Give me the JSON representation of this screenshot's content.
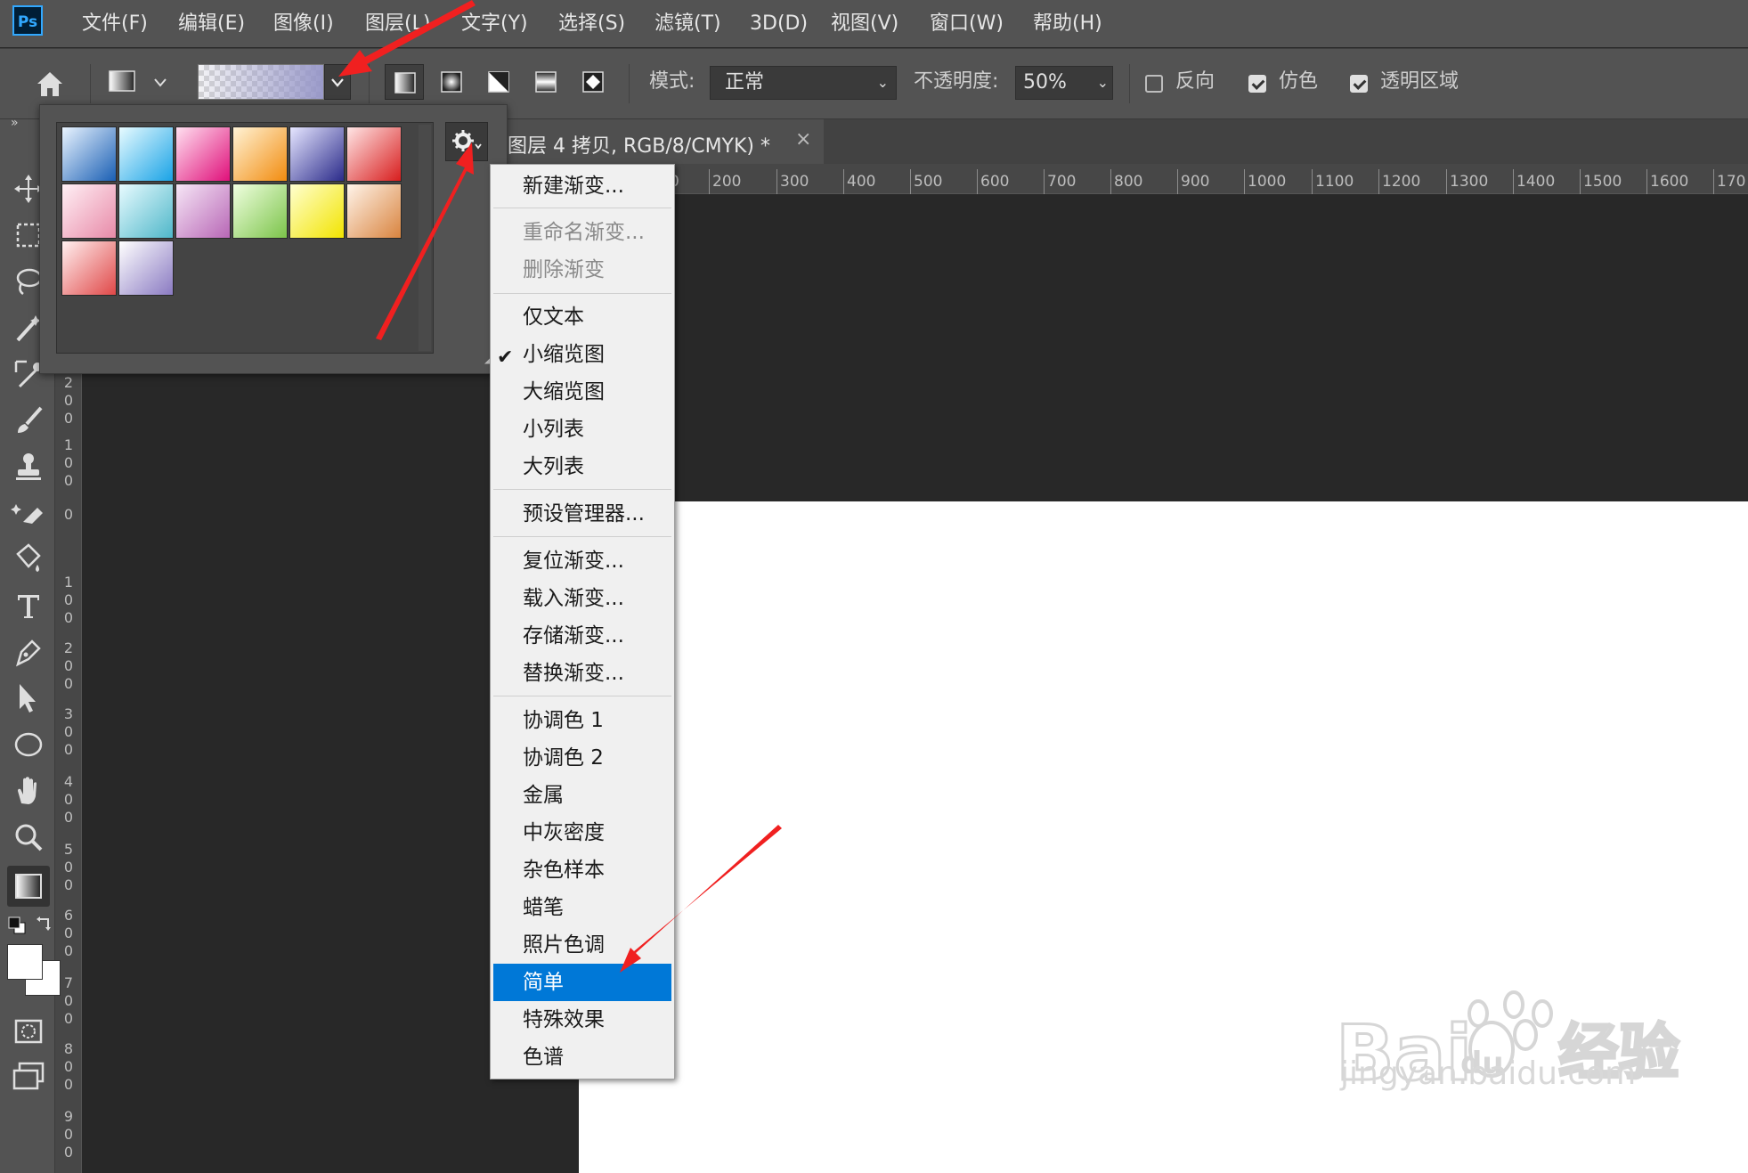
{
  "app": {
    "logo": "Ps"
  },
  "menubar": {
    "items": [
      "文件(F)",
      "编辑(E)",
      "图像(I)",
      "图层(L)",
      "文字(Y)",
      "选择(S)",
      "滤镜(T)",
      "3D(D)",
      "视图(V)",
      "窗口(W)",
      "帮助(H)"
    ]
  },
  "options": {
    "mode_label": "模式:",
    "mode_value": "正常",
    "opacity_label": "不透明度:",
    "opacity_value": "50%",
    "reverse_label": "反向",
    "reverse_checked": false,
    "dither_label": "仿色",
    "dither_checked": true,
    "transparency_label": "透明区域",
    "transparency_checked": true
  },
  "document": {
    "tab_title": "图层 4 拷贝, RGB/8/CMYK) *",
    "close_glyph": "×"
  },
  "ruler": {
    "horizontal": [
      "0",
      "200",
      "300",
      "400",
      "500",
      "600",
      "700",
      "800",
      "900",
      "1000",
      "1100",
      "1200",
      "1300",
      "1400",
      "1500",
      "1600",
      "170"
    ],
    "vertical": [
      "2",
      "0",
      "0",
      "1",
      "0",
      "0",
      "0",
      "1",
      "0",
      "0",
      "2",
      "0",
      "0",
      "3",
      "0",
      "0",
      "4",
      "0",
      "0",
      "5",
      "0",
      "0",
      "6",
      "0",
      "0",
      "7",
      "0",
      "0",
      "8",
      "0",
      "0",
      "9",
      "0",
      "0"
    ]
  },
  "picker": {
    "swatches": [
      {
        "from": "#eaf4ff",
        "to": "#1a5fb4"
      },
      {
        "from": "#e8fbff",
        "to": "#1aa3e6"
      },
      {
        "from": "#ffe0f0",
        "to": "#e0107a"
      },
      {
        "from": "#fff3d6",
        "to": "#f28c0f"
      },
      {
        "from": "#e6e6ff",
        "to": "#2b2b8a"
      },
      {
        "from": "#ffe6e6",
        "to": "#d81e1e"
      },
      {
        "from": "#fff0f5",
        "to": "#e88aa8"
      },
      {
        "from": "#e8fbff",
        "to": "#4fb7c9"
      },
      {
        "from": "#f6e6f6",
        "to": "#b867b6"
      },
      {
        "from": "#f0ffe0",
        "to": "#7cc44a"
      },
      {
        "from": "#ffffd0",
        "to": "#f2e400"
      },
      {
        "from": "#fff4ea",
        "to": "#d9843f"
      },
      {
        "from": "#fff0f0",
        "to": "#e04848"
      },
      {
        "from": "#ffffff",
        "to": "#8a7ac2"
      }
    ]
  },
  "menu": {
    "items": [
      {
        "label": "新建渐变...",
        "disabled": false
      },
      {
        "label": "重命名渐变...",
        "disabled": true
      },
      {
        "label": "删除渐变",
        "disabled": true
      },
      {
        "label": "仅文本",
        "disabled": false
      },
      {
        "label": "小缩览图",
        "disabled": false,
        "checked": true
      },
      {
        "label": "大缩览图",
        "disabled": false
      },
      {
        "label": "小列表",
        "disabled": false
      },
      {
        "label": "大列表",
        "disabled": false
      },
      {
        "label": "预设管理器...",
        "disabled": false
      },
      {
        "label": "复位渐变...",
        "disabled": false
      },
      {
        "label": "载入渐变...",
        "disabled": false
      },
      {
        "label": "存储渐变...",
        "disabled": false
      },
      {
        "label": "替换渐变...",
        "disabled": false
      },
      {
        "label": "协调色 1",
        "disabled": false
      },
      {
        "label": "协调色 2",
        "disabled": false
      },
      {
        "label": "金属",
        "disabled": false
      },
      {
        "label": "中灰密度",
        "disabled": false
      },
      {
        "label": "杂色样本",
        "disabled": false
      },
      {
        "label": "蜡笔",
        "disabled": false
      },
      {
        "label": "照片色调",
        "disabled": false
      },
      {
        "label": "简单",
        "disabled": false,
        "highlighted": true
      },
      {
        "label": "特殊效果",
        "disabled": false
      },
      {
        "label": "色谱",
        "disabled": false
      }
    ]
  },
  "watermark": {
    "text": "jingyan.baidu.com",
    "brand": "Bai du 经验"
  },
  "colors": {
    "annotation_arrow": "#f02020",
    "menu_highlight": "#0078d7"
  }
}
